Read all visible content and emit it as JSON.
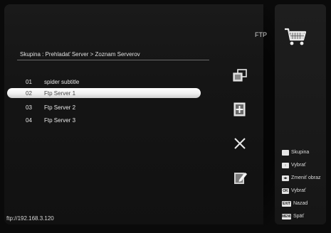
{
  "screen": {
    "title": "FTP"
  },
  "breadcrumb": "Skupina : Prehladať Server > Zoznam Serverov",
  "servers": [
    {
      "num": "01",
      "name": "spider subtitle"
    },
    {
      "num": "02",
      "name": "Ftp Server 1",
      "selected": true
    },
    {
      "num": "03",
      "name": "Ftp Server 2"
    },
    {
      "num": "04",
      "name": "Ftp Server 3"
    }
  ],
  "tools": [
    "copy-icon",
    "add-icon",
    "delete-icon",
    "edit-icon"
  ],
  "status": "ftp://192.168.3.120",
  "legend": [
    {
      "key": "",
      "label": "Skupina",
      "icon": "white-key-icon"
    },
    {
      "key": "↕",
      "label": "Vybrať",
      "icon": "updown-key-icon"
    },
    {
      "key": "◂▸",
      "label": "Zmeniť obraz",
      "icon": "leftright-key-icon"
    },
    {
      "key": "OK",
      "label": "Vybrať",
      "icon": "ok-key-icon"
    },
    {
      "key": "EXIT",
      "label": "Nazad",
      "icon": "exit-key-icon"
    },
    {
      "key": "MENU",
      "label": "Späť",
      "icon": "menu-key-icon"
    }
  ]
}
